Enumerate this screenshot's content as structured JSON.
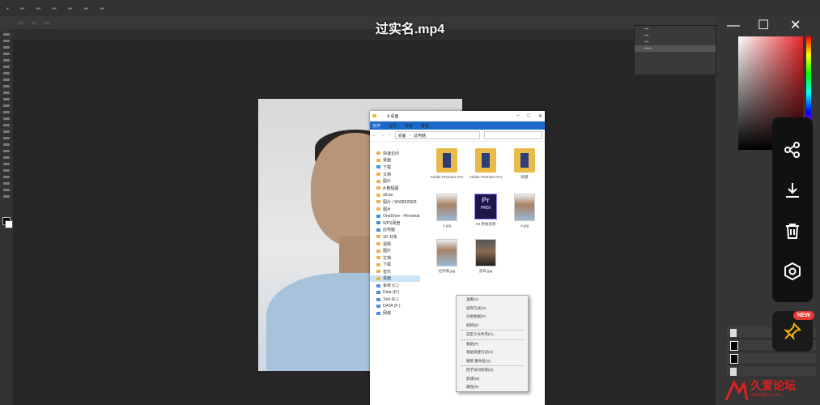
{
  "video": {
    "title": "过实名.mp4"
  },
  "explorer": {
    "title": "A 桌面",
    "ribbon_tabs": [
      "文件",
      "主页",
      "共享",
      "查看"
    ],
    "address": [
      "桌面",
      "此电脑"
    ],
    "nav_items": [
      {
        "label": "快速访问",
        "icon": "star-icon"
      },
      {
        "label": "桌面",
        "icon": "folder-icon"
      },
      {
        "label": "下载",
        "icon": "download-icon"
      },
      {
        "label": "文档",
        "icon": "folder-icon"
      },
      {
        "label": "图片",
        "icon": "folder-icon"
      },
      {
        "label": "A 教程图",
        "icon": "folder-icon"
      },
      {
        "label": "all-ae",
        "icon": "folder-icon"
      },
      {
        "label": "图片 / 9D0B929EB",
        "icon": "folder-icon"
      },
      {
        "label": "图片",
        "icon": "folder-icon"
      },
      {
        "label": "OneDrive - Personal",
        "icon": "cloud-icon"
      },
      {
        "label": "WPS网盘",
        "icon": "cloud-icon"
      },
      {
        "label": "此电脑",
        "icon": "computer-icon"
      },
      {
        "label": "3D 对象",
        "icon": "folder-icon"
      },
      {
        "label": "视频",
        "icon": "folder-icon"
      },
      {
        "label": "图片",
        "icon": "folder-icon"
      },
      {
        "label": "文档",
        "icon": "folder-icon"
      },
      {
        "label": "下载",
        "icon": "folder-icon"
      },
      {
        "label": "音乐",
        "icon": "folder-icon"
      },
      {
        "label": "桌面",
        "icon": "folder-icon"
      },
      {
        "label": "系统 (C:)",
        "icon": "drive-icon"
      },
      {
        "label": "Data (D:)",
        "icon": "drive-icon"
      },
      {
        "label": "Tool (E:)",
        "icon": "drive-icon"
      },
      {
        "label": "DATA (F:)",
        "icon": "drive-icon"
      },
      {
        "label": "网络",
        "icon": "network-icon"
      }
    ],
    "files": [
      {
        "name": "Adobe Premiere Pro",
        "kind": "folder"
      },
      {
        "name": "Adobe Premiere Pro",
        "kind": "folder"
      },
      {
        "name": "新建",
        "kind": "folder"
      },
      {
        "name": "A.jpg",
        "kind": "photo"
      },
      {
        "name": "A0 原始名称",
        "kind": "premiere"
      },
      {
        "name": "A.jpg",
        "kind": "photo"
      },
      {
        "name": "证件照.jpg",
        "kind": "photo"
      },
      {
        "name": "黑白.jpg",
        "kind": "photo-dark"
      }
    ]
  },
  "context_menu": {
    "items": [
      "查看(V)",
      "排序方式(O)",
      "分组依据(P)",
      "刷新(E)",
      "自定义文件夹(F)...",
      "粘贴(P)",
      "粘贴快捷方式(S)",
      "撤销 重命名(U)",
      "授予访问权限(G)",
      "新建(W)",
      "属性(R)"
    ]
  },
  "overlay": {
    "close_glyph": "✕",
    "sidebar_buttons": [
      "share-icon",
      "download-icon",
      "trash-icon",
      "record-icon"
    ],
    "pin_badge": "NEW"
  },
  "watermark": {
    "text": "久爱论坛",
    "url": "www.jiyio.com"
  },
  "colors": {
    "accent_red": "#e0201f",
    "ribbon_blue": "#1b6ac9",
    "picker_hue": "#e8262b"
  }
}
